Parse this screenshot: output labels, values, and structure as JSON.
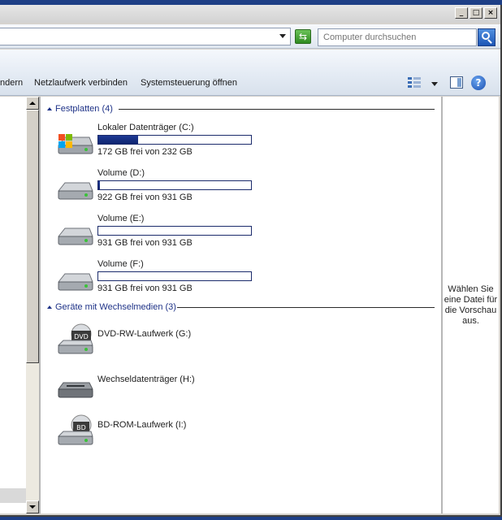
{
  "window": {
    "caption_buttons": [
      "_",
      "□",
      "×"
    ]
  },
  "address_bar": {
    "refresh_icon": "refresh-arrows-icon"
  },
  "search": {
    "placeholder": "Computer durchsuchen"
  },
  "toolbar": {
    "items": [
      "ndern",
      "Netzlaufwerk verbinden",
      "Systemsteuerung öffnen"
    ],
    "help_label": "?"
  },
  "groups": [
    {
      "title": "Festplatten (4)",
      "drives": [
        {
          "name": "Lokaler Datenträger (C:)",
          "free_text": "172 GB frei von 232 GB",
          "used_fraction": 0.26,
          "icon": "windows-hard-disk-icon"
        },
        {
          "name": "Volume (D:)",
          "free_text": "922 GB frei von 931 GB",
          "used_fraction": 0.01,
          "icon": "hard-disk-icon"
        },
        {
          "name": "Volume (E:)",
          "free_text": "931 GB frei von 931 GB",
          "used_fraction": 0.0,
          "icon": "hard-disk-icon"
        },
        {
          "name": "Volume (F:)",
          "free_text": "931 GB frei von 931 GB",
          "used_fraction": 0.0,
          "icon": "hard-disk-icon"
        }
      ]
    },
    {
      "title": "Geräte mit Wechselmedien (3)",
      "drives": [
        {
          "name": "DVD-RW-Laufwerk (G:)",
          "badge": "DVD",
          "icon": "dvd-drive-icon"
        },
        {
          "name": "Wechseldatenträger (H:)",
          "icon": "removable-drive-icon"
        },
        {
          "name": "BD-ROM-Laufwerk (I:)",
          "badge": "BD",
          "icon": "bd-drive-icon"
        }
      ]
    }
  ],
  "preview": {
    "message": "Wählen Sie eine Datei für die Vorschau aus."
  },
  "colors": {
    "group_heading": "#1e3287",
    "usage_bar": "#1f3a94"
  }
}
